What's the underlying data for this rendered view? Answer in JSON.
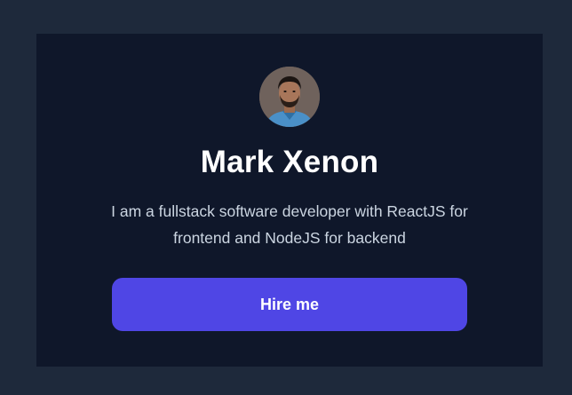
{
  "profile": {
    "name": "Mark Xenon",
    "bio": "I am a fullstack software developer with ReactJS for frontend and NodeJS for backend",
    "avatar_icon": "profile-photo"
  },
  "actions": {
    "hire_label": "Hire me"
  },
  "colors": {
    "page_background": "#1e293b",
    "card_background": "#0f172a",
    "button_background": "#4f46e5",
    "name_text": "#ffffff",
    "bio_text": "#cbd5e1"
  }
}
